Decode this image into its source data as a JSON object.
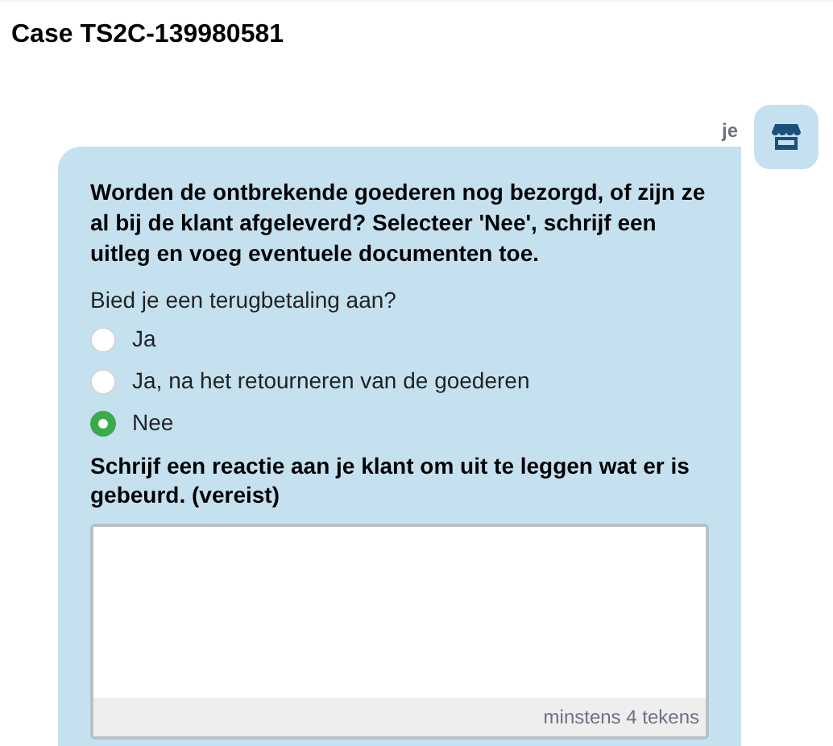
{
  "title": "Case TS2C-139980581",
  "message": {
    "sender": "je",
    "question": "Worden de ontbrekende goederen nog bezorgd, of zijn ze al bij de klant afgeleverd? Selecteer 'Nee', schrijf een uitleg en voeg eventuele documenten toe.",
    "prompt": "Bied je een terugbetaling aan?",
    "options": [
      {
        "label": "Ja",
        "selected": false
      },
      {
        "label": "Ja, na het retourneren van de goederen",
        "selected": false
      },
      {
        "label": "Nee",
        "selected": true
      }
    ],
    "reply_label": "Schrijf een reactie aan je klant om uit te leggen wat er is gebeurd. (vereist)",
    "counter": "minstens 4 tekens"
  }
}
